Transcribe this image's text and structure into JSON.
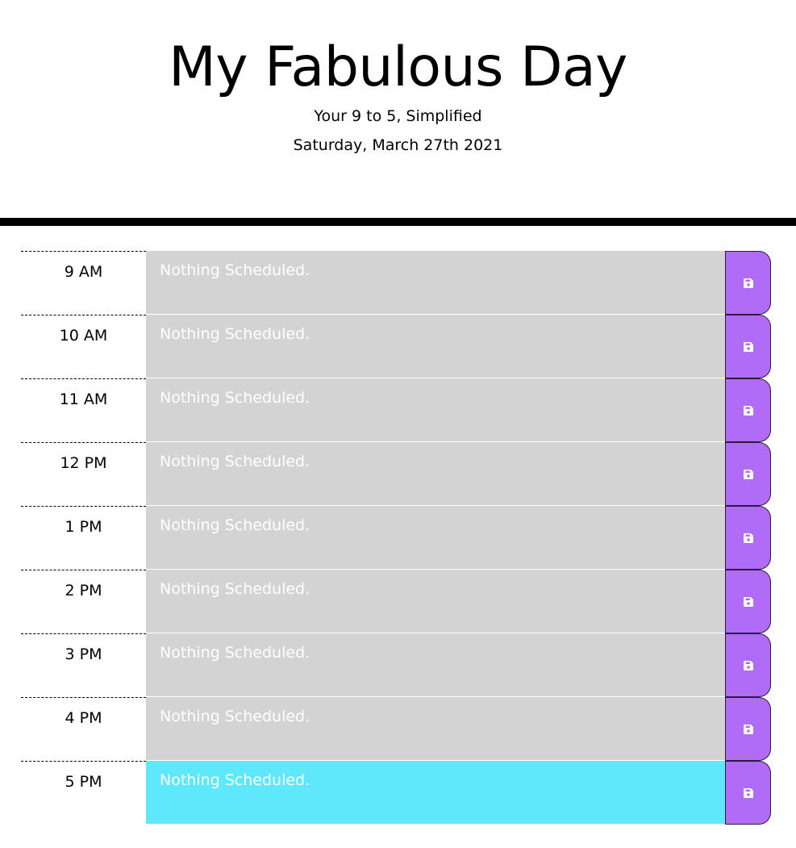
{
  "header": {
    "title": "My Fabulous Day",
    "subtitle": "Your 9 to 5, Simplified",
    "current_date": "Saturday, March 27th 2021"
  },
  "colors": {
    "past": "#d3d3d3",
    "present": "#5fe7fc",
    "save_button": "#b06cf5"
  },
  "time_blocks": [
    {
      "hour": "9 AM",
      "description": "Nothing Scheduled.",
      "state": "past",
      "icon": "save-icon"
    },
    {
      "hour": "10 AM",
      "description": "Nothing Scheduled.",
      "state": "past",
      "icon": "save-icon"
    },
    {
      "hour": "11 AM",
      "description": "Nothing Scheduled.",
      "state": "past",
      "icon": "save-icon"
    },
    {
      "hour": "12 PM",
      "description": "Nothing Scheduled.",
      "state": "past",
      "icon": "save-icon"
    },
    {
      "hour": "1 PM",
      "description": "Nothing Scheduled.",
      "state": "past",
      "icon": "save-icon"
    },
    {
      "hour": "2 PM",
      "description": "Nothing Scheduled.",
      "state": "past",
      "icon": "save-icon"
    },
    {
      "hour": "3 PM",
      "description": "Nothing Scheduled.",
      "state": "past",
      "icon": "save-icon"
    },
    {
      "hour": "4 PM",
      "description": "Nothing Scheduled.",
      "state": "past",
      "icon": "save-icon"
    },
    {
      "hour": "5 PM",
      "description": "Nothing Scheduled.",
      "state": "present",
      "icon": "save-icon"
    }
  ]
}
